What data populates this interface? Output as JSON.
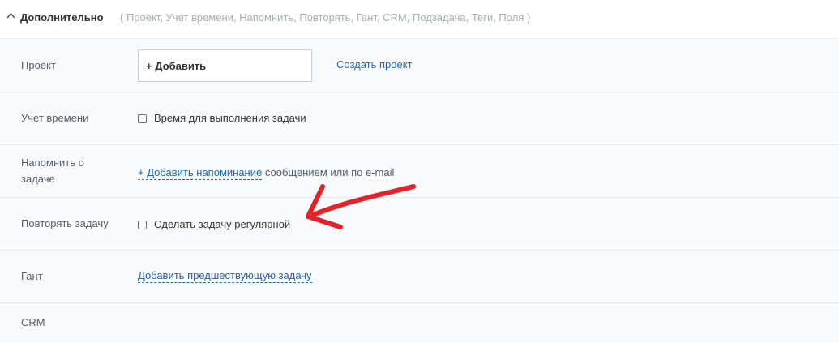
{
  "header": {
    "title": "Дополнительно",
    "sections": "( Проект,  Учет времени,  Напомнить,  Повторять,  Гант,  CRM,  Подзадача,  Теги,  Поля )"
  },
  "rows": {
    "project": {
      "label": "Проект",
      "add_button": "+ Добавить",
      "create_link": "Создать проект"
    },
    "time": {
      "label": "Учет времени",
      "checkbox_label": "Время для выполнения задачи"
    },
    "remind": {
      "label_line1": "Напомнить о",
      "label_line2": "задаче",
      "add_link": "+ Добавить напоминание",
      "suffix": " сообщением или по e-mail"
    },
    "repeat": {
      "label": "Повторять задачу",
      "checkbox_label": "Сделать задачу регулярной"
    },
    "gantt": {
      "label": "Гант",
      "add_link": "Добавить предшествующую задачу"
    },
    "crm": {
      "label": "CRM"
    }
  },
  "colors": {
    "link": "#2067b0",
    "arrow": "#e3222a",
    "panel_bg": "#f9fafb"
  }
}
